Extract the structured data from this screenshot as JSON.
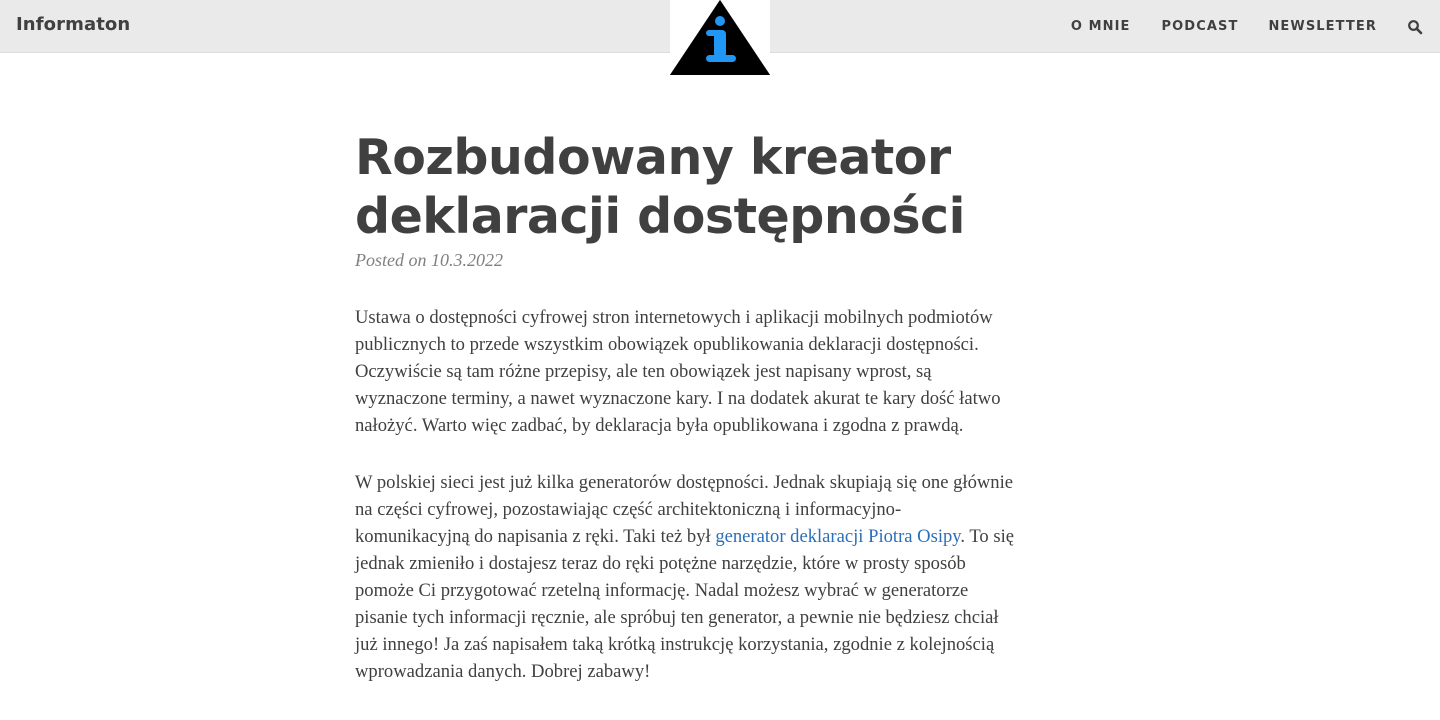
{
  "navbar": {
    "brand": "Informaton",
    "links": [
      "O MNIE",
      "PODCAST",
      "NEWSLETTER"
    ],
    "search_icon": "search-icon"
  },
  "logo": {
    "icon": "info-triangle-logo",
    "accent": "#2196f3"
  },
  "post": {
    "title": "Rozbudowany kreator deklaracji dostępności",
    "meta": "Posted on 10.3.2022",
    "paragraph1": {
      "lines": [
        "Ustawa o dostępności cyfrowej stron internetowych i aplikacji mobilnych podmiotów",
        "publicznych to przede wszystkim obowiązek opublikowania deklaracji dostępności.",
        "Oczywiście są tam różne przepisy, ale ten obowiązek jest napisany wprost, są",
        "wyznaczone terminy, a nawet wyznaczone kary. I na dodatek akurat te kary dość łatwo",
        "nałożyć. Warto więc zadbać, by deklaracja była opublikowana i zgodna z prawdą."
      ]
    },
    "paragraph2": {
      "line1": "W polskiej sieci jest już kilka generatorów dostępności. Jednak skupiają się one głównie",
      "line2": "na części cyfrowej, pozostawiając część architektoniczną i informacyjno-",
      "line3_before": "komunikacyjną do napisania z ręki. Taki też był ",
      "link_text": "generator deklaracji Piotra Osipy",
      "line3_after": ". To się",
      "lines_rest": [
        "jednak zmieniło i dostajesz teraz do ręki potężne narzędzie, które w prosty sposób",
        "pomoże Ci przygotować rzetelną informację. Nadal możesz wybrać w generatorze",
        "pisanie tych informacji ręcznie, ale spróbuj ten generator, a pewnie nie będziesz chciał",
        "już innego! Ja zaś napisałem taką krótką instrukcję korzystania, zgodnie z kolejnością",
        "wprowadzania danych. Dobrej zabawy!"
      ]
    }
  },
  "colors": {
    "link": "#2a6ebb",
    "text": "#404040",
    "navbar_bg": "#eaeaea"
  }
}
